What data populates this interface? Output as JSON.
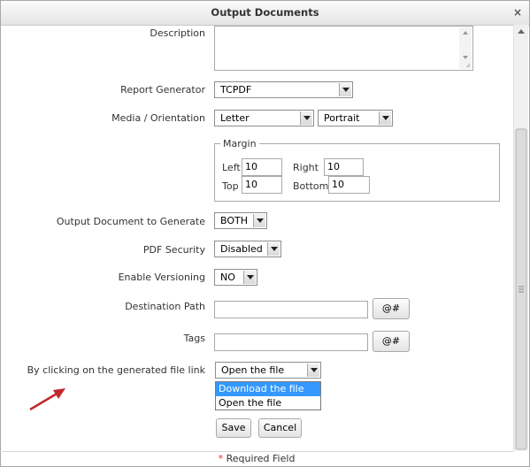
{
  "dialog": {
    "title": "Output Documents",
    "close_glyph": "×"
  },
  "form": {
    "description_label": "Description",
    "report_generator_label": "Report Generator",
    "report_generator_value": "TCPDF",
    "media_label": "Media / Orientation",
    "media_value": "Letter",
    "orientation_value": "Portrait",
    "margin_legend": "Margin",
    "margin_left_label": "Left",
    "margin_left_value": "10",
    "margin_right_label": "Right",
    "margin_right_value": "10",
    "margin_top_label": "Top",
    "margin_top_value": "10",
    "margin_bottom_label": "Bottom",
    "margin_bottom_value": "10",
    "output_doc_label": "Output Document to Generate",
    "output_doc_value": "BOTH",
    "pdf_security_label": "PDF Security",
    "pdf_security_value": "Disabled",
    "versioning_label": "Enable Versioning",
    "versioning_value": "NO",
    "dest_path_label": "Destination Path",
    "dest_path_value": "",
    "var_button_label": "@#",
    "tags_label": "Tags",
    "tags_value": "",
    "file_link_label": "By clicking on the generated file link",
    "file_link_value": "Open the file",
    "file_link_options": [
      "Download the file",
      "Open the file"
    ],
    "save_label": "Save",
    "cancel_label": "Cancel"
  },
  "footer": {
    "asterisk": "*",
    "required_text": "Required Field"
  },
  "colors": {
    "highlight": "#3399ff",
    "arrow": "#c0282d",
    "required": "#dd3333"
  }
}
